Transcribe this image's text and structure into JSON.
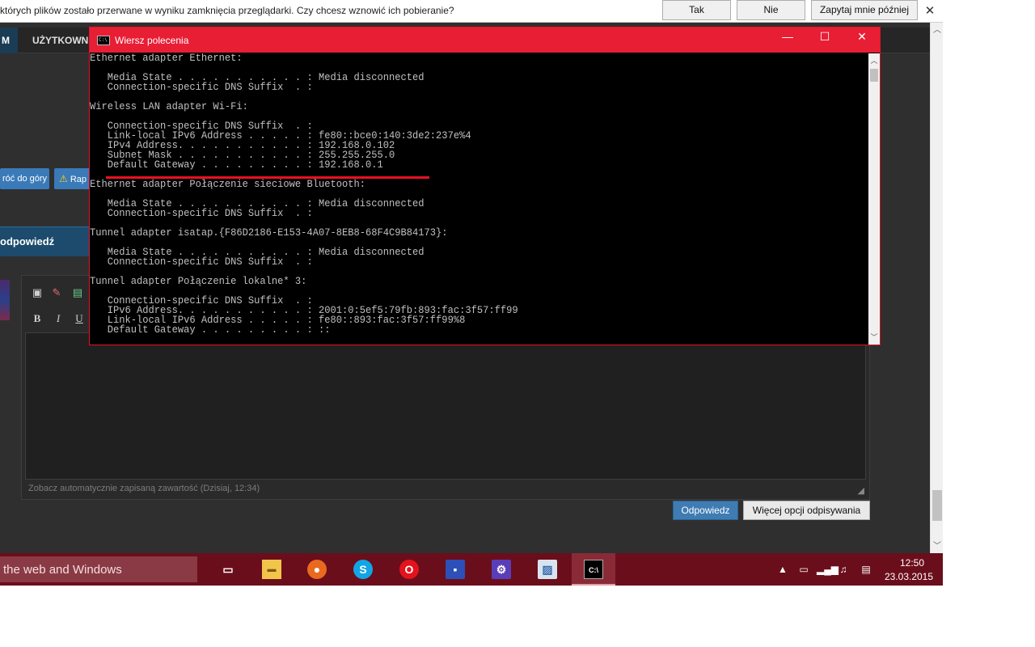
{
  "notification": {
    "message": "których plików zostało przerwane w wyniku zamknięcia przeglądarki. Czy chcesz wznowić ich pobieranie?",
    "yes_label": "Tak",
    "no_label": "Nie",
    "later_label": "Zapytaj mnie później",
    "close_glyph": "✕"
  },
  "forum": {
    "nav_first": "M",
    "nav_users": "UŻYTKOWNIC",
    "back_to_top": "róć do góry",
    "report_label": "Rap",
    "reply_title": "odpowiedź",
    "editor_icons": [
      "clipboard-icon",
      "eraser-icon",
      "image-icon",
      "bold-icon",
      "italic-icon",
      "underline-icon"
    ],
    "editor_bold": "B",
    "editor_italic": "I",
    "editor_underline": "U",
    "autosave_text": "Zobacz automatycznie zapisaną zawartość (Dzisiaj, 12:34)",
    "reply_button": "Odpowiedz",
    "more_options_button": "Więcej opcji odpisywania"
  },
  "cmd": {
    "title": "Wiersz polecenia",
    "icon_text": "C:\\",
    "lines": [
      "Ethernet adapter Ethernet:",
      "",
      "   Media State . . . . . . . . . . . : Media disconnected",
      "   Connection-specific DNS Suffix  . :",
      "",
      "Wireless LAN adapter Wi-Fi:",
      "",
      "   Connection-specific DNS Suffix  . :",
      "   Link-local IPv6 Address . . . . . : fe80::bce0:140:3de2:237e%4",
      "   IPv4 Address. . . . . . . . . . . : 192.168.0.102",
      "   Subnet Mask . . . . . . . . . . . : 255.255.255.0",
      "   Default Gateway . . . . . . . . . : 192.168.0.1",
      "",
      "Ethernet adapter Połączenie sieciowe Bluetooth:",
      "",
      "   Media State . . . . . . . . . . . : Media disconnected",
      "   Connection-specific DNS Suffix  . :",
      "",
      "Tunnel adapter isatap.{F86D2186-E153-4A07-8EB8-68F4C9B84173}:",
      "",
      "   Media State . . . . . . . . . . . : Media disconnected",
      "   Connection-specific DNS Suffix  . :",
      "",
      "Tunnel adapter Połączenie lokalne* 3:",
      "",
      "   Connection-specific DNS Suffix  . :",
      "   IPv6 Address. . . . . . . . . . . : 2001:0:5ef5:79fb:893:fac:3f57:ff99",
      "   Link-local IPv6 Address . . . . . : fe80::893:fac:3f57:ff99%8",
      "   Default Gateway . . . . . . . . . : ::"
    ]
  },
  "taskbar": {
    "search_text": "the web and Windows",
    "apps": [
      "task-view-icon",
      "file-explorer-icon",
      "firefox-icon",
      "skype-icon",
      "opera-icon",
      "save-app-icon",
      "settings-app-icon",
      "photo-viewer-icon",
      "command-prompt-icon"
    ],
    "time": "12:50",
    "date": "23.03.2015"
  },
  "colors": {
    "cmd_title_bar": "#e81e35",
    "taskbar": "#6b0e1b",
    "highlight_underline": "#e81123",
    "forum_accent": "#1c4b6d"
  }
}
